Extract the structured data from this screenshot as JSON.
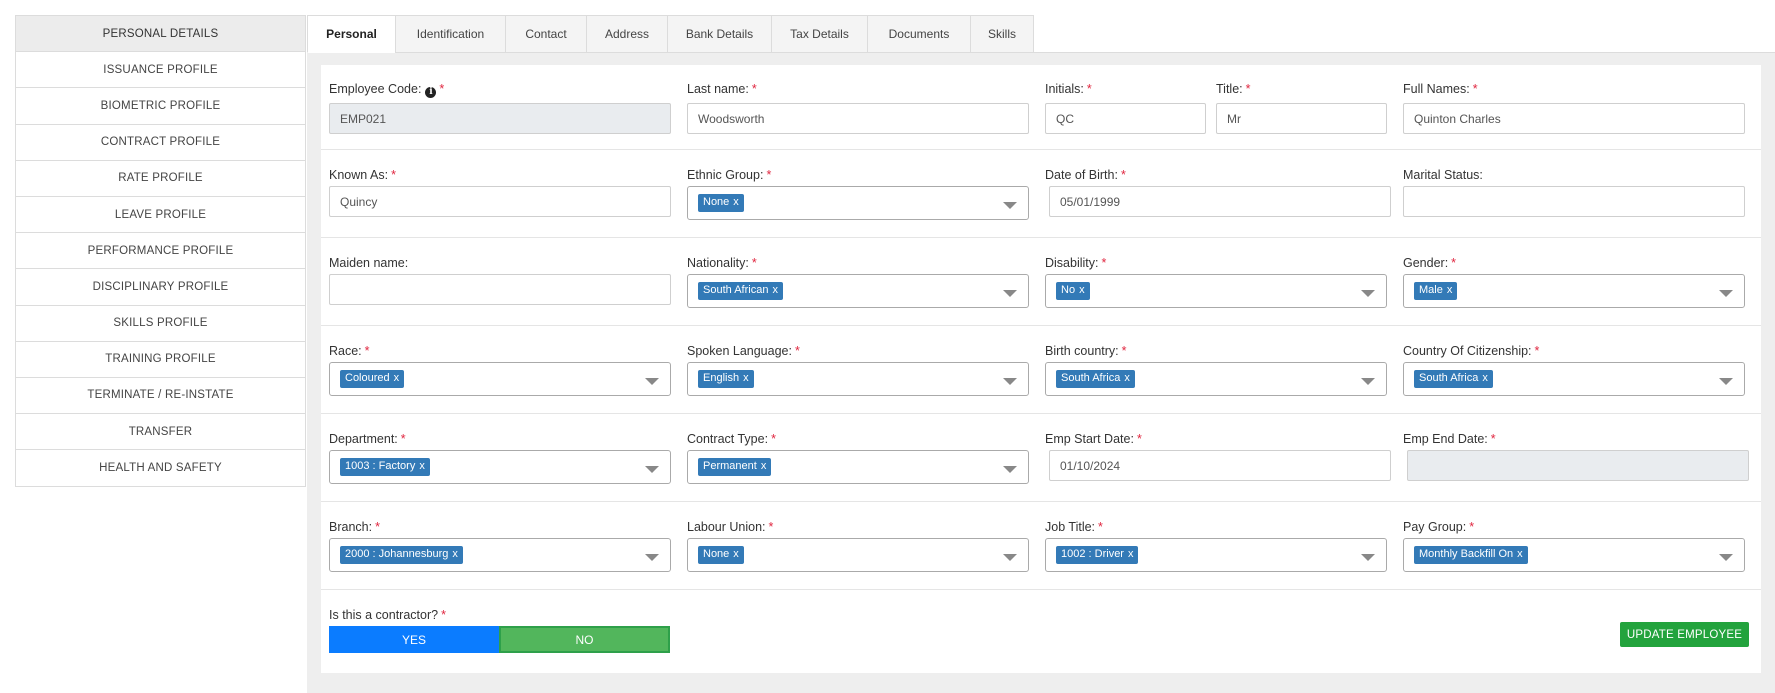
{
  "sidebar": {
    "items": [
      {
        "label": "PERSONAL DETAILS",
        "active": true
      },
      {
        "label": "ISSUANCE PROFILE"
      },
      {
        "label": "BIOMETRIC PROFILE"
      },
      {
        "label": "CONTRACT PROFILE"
      },
      {
        "label": "RATE PROFILE"
      },
      {
        "label": "LEAVE PROFILE"
      },
      {
        "label": "PERFORMANCE PROFILE"
      },
      {
        "label": "DISCIPLINARY PROFILE"
      },
      {
        "label": "SKILLS PROFILE"
      },
      {
        "label": "TRAINING PROFILE"
      },
      {
        "label": "TERMINATE / RE-INSTATE"
      },
      {
        "label": "TRANSFER"
      },
      {
        "label": "HEALTH AND SAFETY"
      }
    ]
  },
  "tabs": [
    {
      "label": "Personal",
      "active": true
    },
    {
      "label": "Identification"
    },
    {
      "label": "Contact"
    },
    {
      "label": "Address"
    },
    {
      "label": "Bank Details"
    },
    {
      "label": "Tax Details"
    },
    {
      "label": "Documents"
    },
    {
      "label": "Skills"
    }
  ],
  "form": {
    "employee_code": {
      "label": "Employee Code:",
      "value": "EMP021"
    },
    "last_name": {
      "label": "Last name:",
      "value": "Woodsworth"
    },
    "initials": {
      "label": "Initials:",
      "value": "QC"
    },
    "title": {
      "label": "Title:",
      "value": "Mr"
    },
    "full_names": {
      "label": "Full Names:",
      "value": "Quinton Charles"
    },
    "known_as": {
      "label": "Known As:",
      "value": "Quincy"
    },
    "ethnic_group": {
      "label": "Ethnic Group:",
      "value": "None"
    },
    "date_of_birth": {
      "label": "Date of Birth:",
      "value": "05/01/1999"
    },
    "marital_status": {
      "label": "Marital Status:",
      "value": ""
    },
    "maiden_name": {
      "label": "Maiden name:",
      "value": ""
    },
    "nationality": {
      "label": "Nationality:",
      "value": "South African"
    },
    "disability": {
      "label": "Disability:",
      "value": "No"
    },
    "gender": {
      "label": "Gender:",
      "value": "Male"
    },
    "race": {
      "label": "Race:",
      "value": "Coloured"
    },
    "spoken_language": {
      "label": "Spoken Language:",
      "value": "English"
    },
    "birth_country": {
      "label": "Birth country:",
      "value": "South Africa"
    },
    "country_of_citizenship": {
      "label": "Country Of Citizenship:",
      "value": "South Africa"
    },
    "department": {
      "label": "Department:",
      "value": "1003 : Factory"
    },
    "contract_type": {
      "label": "Contract Type:",
      "value": "Permanent"
    },
    "emp_start_date": {
      "label": "Emp Start Date:",
      "value": "01/10/2024"
    },
    "emp_end_date": {
      "label": "Emp End Date:",
      "value": ""
    },
    "branch": {
      "label": "Branch:",
      "value": "2000 : Johannesburg"
    },
    "labour_union": {
      "label": "Labour Union:",
      "value": "None"
    },
    "job_title": {
      "label": "Job Title:",
      "value": "1002 : Driver"
    },
    "pay_group": {
      "label": "Pay Group:",
      "value": "Monthly Backfill On"
    },
    "contractor": {
      "label": "Is this a contractor?",
      "yes": "YES",
      "no": "NO",
      "selected": "NO"
    }
  },
  "chip_remove": "x",
  "required_mark": "*",
  "info_glyph": "i",
  "update_button": "UPDATE EMPLOYEE",
  "colors": {
    "chip": "#337ab7",
    "required": "#e0263f",
    "yes_button": "#0b7cff",
    "no_button": "#52b65c",
    "update_button": "#23a33d"
  }
}
